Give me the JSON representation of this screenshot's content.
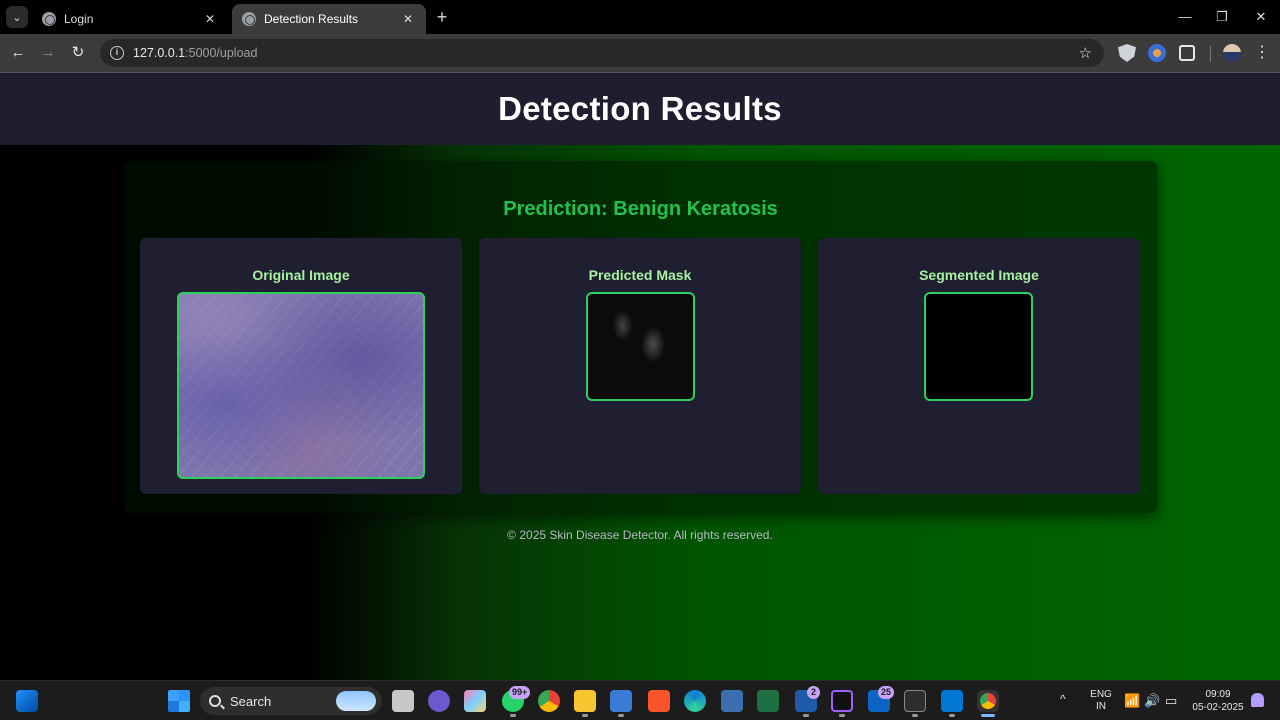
{
  "browser": {
    "tabs": [
      {
        "title": "Login",
        "active": false
      },
      {
        "title": "Detection Results",
        "active": true
      }
    ],
    "url_host": "127.0.0.1",
    "url_path": ":5000/upload",
    "tab_menu_glyph": "⌄",
    "close_glyph": "✕",
    "new_tab_glyph": "+",
    "minimize_glyph": "—",
    "restore_glyph": "❐",
    "window_close_glyph": "✕",
    "back_glyph": "←",
    "forward_glyph": "→",
    "reload_glyph": "↻",
    "star_glyph": "☆",
    "info_glyph": "i",
    "menu_glyph": "⋮"
  },
  "page": {
    "header_title": "Detection Results",
    "prediction_text": "Prediction: Benign Keratosis",
    "panels": [
      {
        "title": "Original Image"
      },
      {
        "title": "Predicted Mask"
      },
      {
        "title": "Segmented Image"
      }
    ],
    "footer": "© 2025 Skin Disease Detector. All rights reserved.",
    "colors": {
      "header_bg": "#1e1e30",
      "prediction": "#21c24d",
      "panel_title": "#a8f0a0",
      "image_border": "#2ecf5c",
      "bg_gradient_end": "#006600"
    }
  },
  "taskbar": {
    "search_label": "Search",
    "apps": [
      {
        "name": "task-view-icon"
      },
      {
        "name": "meet-icon"
      },
      {
        "name": "copilot-icon"
      },
      {
        "name": "whatsapp-icon",
        "badge": "99+"
      },
      {
        "name": "chrome-icon"
      },
      {
        "name": "file-explorer-icon"
      },
      {
        "name": "notepad-icon"
      },
      {
        "name": "brave-icon"
      },
      {
        "name": "edge-icon"
      },
      {
        "name": "sql-server-icon"
      },
      {
        "name": "excel-icon"
      },
      {
        "name": "lync-icon",
        "badge": "2"
      },
      {
        "name": "intellij-icon"
      },
      {
        "name": "linkedin-icon",
        "badge": "25"
      },
      {
        "name": "terminal-icon"
      },
      {
        "name": "vscode-icon"
      },
      {
        "name": "chrome-active-icon"
      }
    ],
    "chevron_glyph": "^",
    "lang_line1": "ENG",
    "lang_line2": "IN",
    "wifi_glyph": "📶",
    "volume_glyph": "🔊",
    "battery_glyph": "▭",
    "time": "09:09",
    "date": "05-02-2025"
  }
}
